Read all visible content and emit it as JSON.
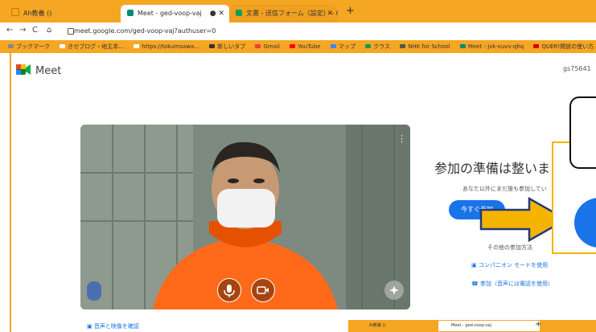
{
  "browser": {
    "tabs": [
      {
        "label": "Ah教養 ()",
        "color": "#f5a623"
      },
      {
        "label": "Meet - ged-voop-vaj",
        "color": "#00897b"
      },
      {
        "label": "文書 - 送信フォーム（設定） - Goo...",
        "color": "#0f9d58"
      }
    ],
    "url": "meet.google.com/ged-voop-vaj?authuser=0",
    "bookmarks": [
      "ブックマーク",
      "きせブログ・地主本...",
      "https://tokumsawa...",
      "新しいタブ",
      "Gmail",
      "YouTube",
      "マップ",
      "クラス",
      "NHK for School",
      "Meet - jvk-vuvv-qhq",
      "QUER!開放の使い方..."
    ]
  },
  "meet": {
    "logo_text": "Meet",
    "account": "gs75641",
    "ready_title": "参加の準備は整いま",
    "ready_subtitle": "あなた以外にまだ誰も参加してい",
    "join_label": "今すぐ参加",
    "other_ways": "その他の参加方法",
    "companion": "コンパニオン モードを使用",
    "phone_join": "参加（音声には電話を使用）",
    "check_av": "音声と映像を確認",
    "video_menu": "⋮"
  },
  "bottom_tabs": [
    {
      "label": "AI教養 ()"
    },
    {
      "label": "Meet - ged-voop-vaj"
    }
  ]
}
